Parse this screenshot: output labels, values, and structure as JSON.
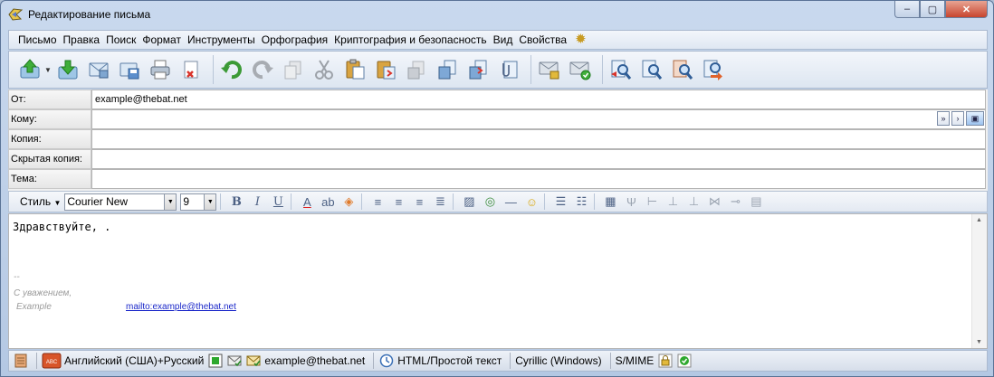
{
  "window": {
    "title": "Редактирование письма",
    "btn_min": "‒",
    "btn_max": "▢",
    "btn_close": "✕"
  },
  "menu": [
    "Письмо",
    "Правка",
    "Поиск",
    "Формат",
    "Инструменты",
    "Орфография",
    "Криптография и безопасность",
    "Вид",
    "Свойства"
  ],
  "toolbar": {
    "icons": [
      "send-icon",
      "receive-icon",
      "queue-icon",
      "save-icon",
      "print-icon",
      "delete-icon",
      "undo-icon",
      "redo-icon",
      "copy-disabled-icon",
      "cut-icon",
      "paste-icon",
      "paste-quote-icon",
      "copy2-icon",
      "copy3-icon",
      "attach-icon",
      "clip-icon",
      "lock-mail-icon",
      "sign-mail-icon",
      "find-prev-icon",
      "find-icon",
      "find-next-icon",
      "replace-icon"
    ]
  },
  "fields": {
    "from_label": "От:",
    "from_value": "example@thebat.net",
    "to_label": "Кому:",
    "to_value": "",
    "cc_label": "Копия:",
    "cc_value": "",
    "bcc_label": "Скрытая копия:",
    "bcc_value": "",
    "subject_label": "Тема:",
    "subject_value": ""
  },
  "format": {
    "style_label": "Стиль",
    "font": "Courier New",
    "size": "9"
  },
  "editor": {
    "body": "Здравствуйте, .",
    "sig_dash": "--",
    "sig_regards": "С уважением,",
    "sig_name": "Example",
    "sig_link": "mailto:example@thebat.net"
  },
  "status": {
    "language": "Английский (США)+Русский",
    "account": "example@thebat.net",
    "format": "HTML/Простой текст",
    "encoding": "Cyrillic (Windows)",
    "security": "S/MIME"
  },
  "colors": {
    "accent": "#3a6fb5",
    "link": "#1a27c9",
    "signature": "#9a9a9a"
  }
}
